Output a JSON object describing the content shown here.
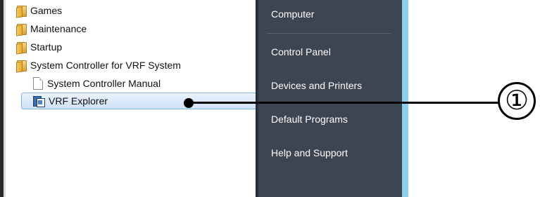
{
  "program_list": {
    "items": [
      {
        "label": "Games",
        "icon": "folder-icon"
      },
      {
        "label": "Maintenance",
        "icon": "folder-icon"
      },
      {
        "label": "Startup",
        "icon": "folder-icon"
      },
      {
        "label": "System Controller for VRF System",
        "icon": "folder-icon"
      },
      {
        "label": "System Controller Manual",
        "icon": "document-icon"
      },
      {
        "label": "VRF Explorer",
        "icon": "app-icon",
        "selected": true
      }
    ]
  },
  "right_menu": {
    "items": [
      {
        "label": "Computer"
      },
      {
        "label": "Control Panel"
      },
      {
        "label": "Devices and Printers"
      },
      {
        "label": "Default Programs"
      },
      {
        "label": "Help and Support"
      }
    ]
  },
  "callout": {
    "label": "①"
  },
  "colors": {
    "panel_bg": "#3d4552",
    "selection_border": "#7fb0e8",
    "frame_accent": "#8fd0ec"
  }
}
